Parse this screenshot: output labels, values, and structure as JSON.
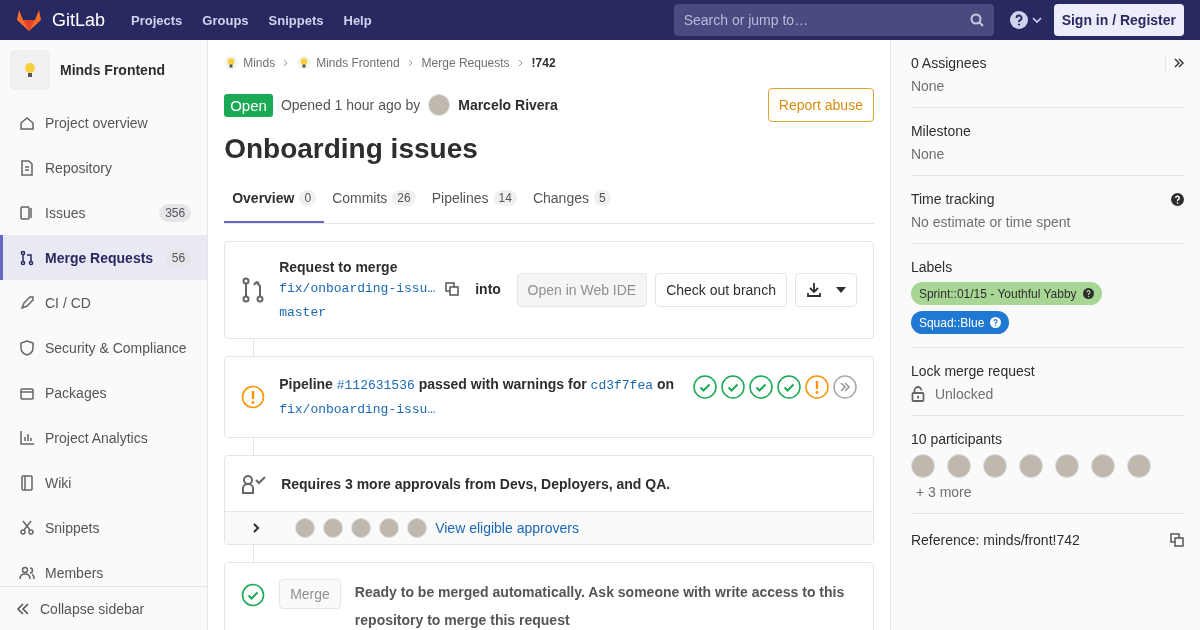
{
  "topbar": {
    "brand": "GitLab",
    "nav": [
      "Projects",
      "Groups",
      "Snippets",
      "Help"
    ],
    "search": {
      "placeholder": "Search or jump to…"
    },
    "sign_in": "Sign in / Register"
  },
  "sidebar": {
    "project": "Minds Frontend",
    "items": [
      {
        "label": "Project overview",
        "selected": false
      },
      {
        "label": "Repository",
        "selected": false
      },
      {
        "label": "Issues",
        "count": "356",
        "selected": false
      },
      {
        "label": "Merge Requests",
        "count": "56",
        "selected": true
      },
      {
        "label": "CI / CD",
        "selected": false
      },
      {
        "label": "Security & Compliance",
        "selected": false
      },
      {
        "label": "Packages",
        "selected": false
      },
      {
        "label": "Project Analytics",
        "selected": false
      },
      {
        "label": "Wiki",
        "selected": false
      },
      {
        "label": "Snippets",
        "selected": false
      },
      {
        "label": "Members",
        "selected": false
      }
    ],
    "collapse": "Collapse sidebar"
  },
  "breadcrumbs": [
    {
      "label": "Minds",
      "kind": "group"
    },
    {
      "label": "Minds Frontend",
      "kind": "group"
    },
    {
      "label": "Merge Requests",
      "kind": "link"
    },
    {
      "label": "!742",
      "kind": "current"
    }
  ],
  "header": {
    "status": "Open",
    "opened": "Opened 1 hour ago by",
    "author": "Marcelo Rivera",
    "report": "Report abuse"
  },
  "title": "Onboarding issues",
  "tabs": [
    {
      "label": "Overview",
      "count": "0",
      "selected": true
    },
    {
      "label": "Commits",
      "count": "26",
      "selected": false
    },
    {
      "label": "Pipelines",
      "count": "14",
      "selected": false
    },
    {
      "label": "Changes",
      "count": "5",
      "selected": false
    }
  ],
  "merge_info": {
    "heading": "Request to merge",
    "source_branch": "fix/onboarding-issu…",
    "into": "into",
    "target_branch": "master",
    "buttons": [
      {
        "label": "Open in Web IDE",
        "disabled": true
      },
      {
        "label": "Check out branch",
        "disabled": false
      }
    ]
  },
  "pipeline": {
    "prefix": "Pipeline",
    "id": "#112631536",
    "status_text": "passed with warnings for",
    "commit": "cd3f7fea",
    "on": "on",
    "branch": "fix/onboarding-issu…",
    "stages": [
      {
        "kind": "success"
      },
      {
        "kind": "success"
      },
      {
        "kind": "success"
      },
      {
        "kind": "success"
      },
      {
        "kind": "warning"
      }
    ]
  },
  "approvals": {
    "text": "Requires 3 more approvals from Devs, Deployers, and QA.",
    "expanded": false,
    "link": "View eligible approvers"
  },
  "merge": {
    "button": "Merge",
    "disabled": true,
    "text": "Ready to be merged automatically. Ask someone with write access to this repository to merge this request"
  },
  "right_sidebar": {
    "assignees": {
      "title": "0 Assignees",
      "value": "None"
    },
    "milestone": {
      "title": "Milestone",
      "value": "None"
    },
    "time_tracking": {
      "title": "Time tracking",
      "value": "No estimate or time spent"
    },
    "labels": {
      "title": "Labels",
      "items": [
        {
          "text": "Sprint::01/15 - Youthful Yabby",
          "color": "#a8d695"
        },
        {
          "text": "Squad::Blue",
          "color": "#1f78d1"
        }
      ]
    },
    "lock": {
      "title": "Lock merge request",
      "value": "Unlocked",
      "locked": false
    },
    "participants": {
      "title": "10 participants",
      "more": "+ 3 more"
    },
    "reference": "Reference: minds/front!742"
  }
}
